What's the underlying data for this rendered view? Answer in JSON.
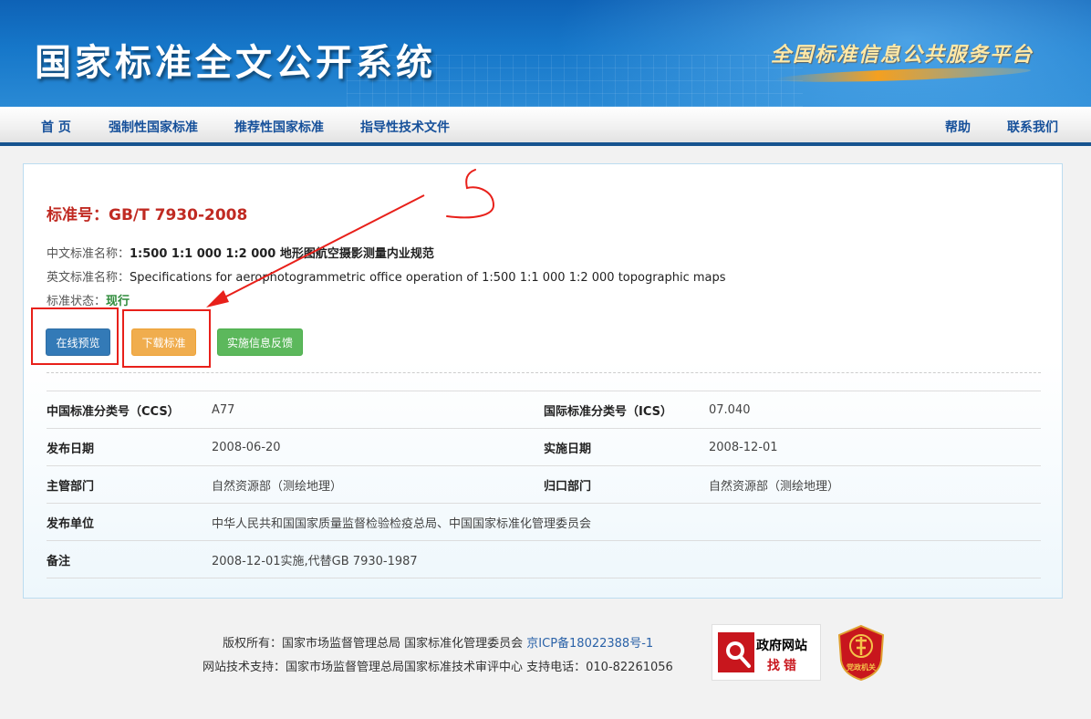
{
  "header": {
    "site_title": "国家标准全文公开系统",
    "slogan": "全国标准信息公共服务平台"
  },
  "nav": {
    "items": [
      {
        "label": "首 页"
      },
      {
        "label": "强制性国家标准"
      },
      {
        "label": "推荐性国家标准"
      },
      {
        "label": "指导性技术文件"
      }
    ],
    "right_items": [
      {
        "label": "帮助"
      },
      {
        "label": "联系我们"
      }
    ]
  },
  "standard": {
    "number_label": "标准号：",
    "number": "GB/T 7930-2008",
    "cn_name_label": "中文标准名称：",
    "cn_name": "1:500 1:1 000 1:2 000 地形图航空摄影测量内业规范",
    "en_name_label": "英文标准名称：",
    "en_name": "Specifications for aerophotogrammetric office operation of 1:500 1:1 000 1:2 000 topographic maps",
    "status_label": "标准状态：",
    "status": "现行"
  },
  "actions": {
    "preview": "在线预览",
    "download": "下载标准",
    "feedback": "实施信息反馈"
  },
  "annotation": {
    "handwritten": "5",
    "colors": {
      "mark": "#e8201a"
    }
  },
  "meta": {
    "rows": [
      {
        "k1": "中国标准分类号（CCS）",
        "v1": "A77",
        "k2": "国际标准分类号（ICS）",
        "v2": "07.040"
      },
      {
        "k1": "发布日期",
        "v1": "2008-06-20",
        "k2": "实施日期",
        "v2": "2008-12-01"
      },
      {
        "k1": "主管部门",
        "v1": "自然资源部（测绘地理）",
        "k2": "归口部门",
        "v2": "自然资源部（测绘地理）"
      },
      {
        "k1": "发布单位",
        "v1": "中华人民共和国国家质量监督检验检疫总局、中国国家标准化管理委员会"
      },
      {
        "k1": "备注",
        "v1": "2008-12-01实施,代替GB 7930-1987"
      }
    ]
  },
  "footer": {
    "copyright": "版权所有：国家市场监督管理总局 国家标准化管理委员会",
    "icp": "京ICP备18022388号-1",
    "support": "网站技术支持：国家市场监督管理总局国家标准技术审评中心 支持电话：010-82261056",
    "gov_badge_title": "政府网站",
    "gov_badge_sub": "找错",
    "party_badge": "党政机关"
  }
}
